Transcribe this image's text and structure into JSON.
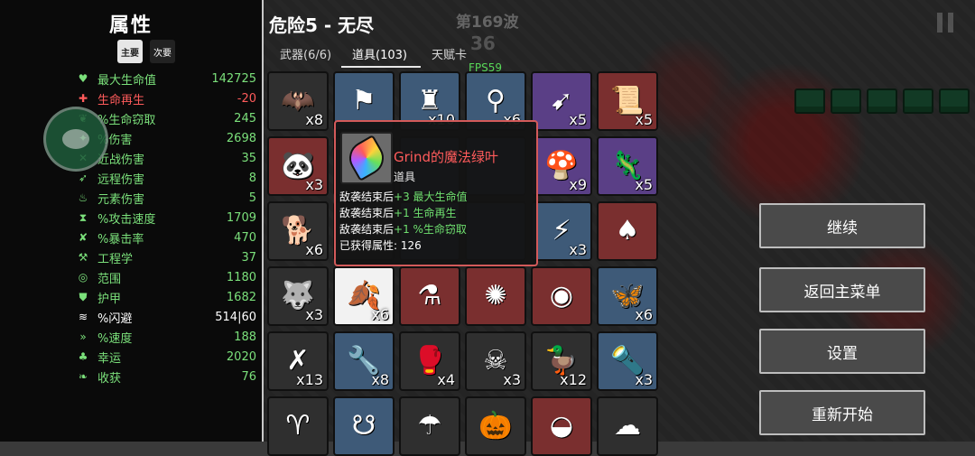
{
  "header": {
    "title": "危险5 - 无尽",
    "wave_label": "第169波",
    "wave_count": "36",
    "fps": "FPS59"
  },
  "tabs": [
    {
      "label": "武器(6/6)",
      "active": false
    },
    {
      "label": "道具(103)",
      "active": true
    },
    {
      "label": "天赋卡",
      "active": false
    }
  ],
  "stats_panel": {
    "title": "属性",
    "toggle": [
      {
        "label": "主要",
        "active": true
      },
      {
        "label": "次要",
        "active": false
      }
    ],
    "stats": [
      {
        "icon": "heart-icon",
        "glyph": "♥",
        "label": "最大生命值",
        "value": "142725",
        "color": "#7be07b"
      },
      {
        "icon": "regen-icon",
        "glyph": "✚",
        "label": "生命再生",
        "value": "-20",
        "color": "#ff5b5b"
      },
      {
        "icon": "lifesteal-icon",
        "glyph": "❦",
        "label": "%生命窃取",
        "value": "245",
        "color": "#7be07b"
      },
      {
        "icon": "damage-icon",
        "glyph": "✦",
        "label": "%伤害",
        "value": "2698",
        "color": "#7be07b"
      },
      {
        "icon": "melee-icon",
        "glyph": "✕",
        "label": "近战伤害",
        "value": "35",
        "color": "#7be07b"
      },
      {
        "icon": "ranged-icon",
        "glyph": "➶",
        "label": "远程伤害",
        "value": "8",
        "color": "#7be07b"
      },
      {
        "icon": "elemental-icon",
        "glyph": "♨",
        "label": "元素伤害",
        "value": "5",
        "color": "#7be07b"
      },
      {
        "icon": "attack-speed-icon",
        "glyph": "⧗",
        "label": "%攻击速度",
        "value": "1709",
        "color": "#7be07b"
      },
      {
        "icon": "crit-icon",
        "glyph": "✘",
        "label": "%暴击率",
        "value": "470",
        "color": "#7be07b"
      },
      {
        "icon": "engineering-icon",
        "glyph": "⚒",
        "label": "工程学",
        "value": "37",
        "color": "#7be07b"
      },
      {
        "icon": "range-icon",
        "glyph": "◎",
        "label": "范围",
        "value": "1180",
        "color": "#7be07b"
      },
      {
        "icon": "armor-icon",
        "glyph": "⛊",
        "label": "护甲",
        "value": "1682",
        "color": "#7be07b"
      },
      {
        "icon": "dodge-icon",
        "glyph": "≋",
        "label": "%闪避",
        "value": "514|60",
        "color": "#ffffff"
      },
      {
        "icon": "speed-icon",
        "glyph": "»",
        "label": "%速度",
        "value": "188",
        "color": "#7be07b"
      },
      {
        "icon": "luck-icon",
        "glyph": "♣",
        "label": "幸运",
        "value": "2020",
        "color": "#7be07b"
      },
      {
        "icon": "harvest-icon",
        "glyph": "❧",
        "label": "收获",
        "value": "76",
        "color": "#7be07b"
      }
    ]
  },
  "items": [
    {
      "name": "item-bat",
      "glyph": "🦇",
      "rarity": "r-gray",
      "qty": "x8"
    },
    {
      "name": "item-banner",
      "glyph": "⚑",
      "rarity": "r-blue",
      "qty": ""
    },
    {
      "name": "item-totem",
      "glyph": "♜",
      "rarity": "r-blue",
      "qty": "x10"
    },
    {
      "name": "item-cannon",
      "glyph": "⚲",
      "rarity": "r-blue",
      "qty": "x6"
    },
    {
      "name": "item-rocket",
      "glyph": "➹",
      "rarity": "r-purple",
      "qty": "x5"
    },
    {
      "name": "item-scroll",
      "glyph": "📜",
      "rarity": "r-red",
      "qty": "x5"
    },
    {
      "name": "item-panda",
      "glyph": "🐼",
      "rarity": "r-red",
      "qty": "x3"
    },
    {
      "name": "item-hidden-1",
      "glyph": "",
      "rarity": "r-gray",
      "qty": ""
    },
    {
      "name": "item-hidden-2",
      "glyph": "",
      "rarity": "r-blue",
      "qty": ""
    },
    {
      "name": "item-hidden-3",
      "glyph": "",
      "rarity": "r-blue",
      "qty": ""
    },
    {
      "name": "item-mushroom",
      "glyph": "🍄",
      "rarity": "r-purple",
      "qty": "x9"
    },
    {
      "name": "item-chameleon",
      "glyph": "🦎",
      "rarity": "r-purple",
      "qty": "x5"
    },
    {
      "name": "item-dog",
      "glyph": "🐕",
      "rarity": "r-gray",
      "qty": "x6"
    },
    {
      "name": "item-hidden-4",
      "glyph": "",
      "rarity": "r-gray",
      "qty": ""
    },
    {
      "name": "item-hidden-5",
      "glyph": "",
      "rarity": "r-blue",
      "qty": ""
    },
    {
      "name": "item-hidden-6",
      "glyph": "",
      "rarity": "r-blue",
      "qty": ""
    },
    {
      "name": "item-net",
      "glyph": "⚡",
      "rarity": "r-blue",
      "qty": "x3"
    },
    {
      "name": "item-stomach",
      "glyph": "♠",
      "rarity": "r-red",
      "qty": ""
    },
    {
      "name": "item-wolf",
      "glyph": "🐺",
      "rarity": "r-gray",
      "qty": "x3"
    },
    {
      "name": "item-rainbow-leaf",
      "glyph": "🍂",
      "rarity": "r-white",
      "qty": "x6"
    },
    {
      "name": "item-potion",
      "glyph": "⚗",
      "rarity": "r-red",
      "qty": ""
    },
    {
      "name": "item-virus",
      "glyph": "✺",
      "rarity": "r-red",
      "qty": ""
    },
    {
      "name": "item-coin",
      "glyph": "◉",
      "rarity": "r-red",
      "qty": ""
    },
    {
      "name": "item-dragonfly",
      "glyph": "🦋",
      "rarity": "r-blue",
      "qty": "x6"
    },
    {
      "name": "item-claw",
      "glyph": "✗",
      "rarity": "r-gray",
      "qty": "x13"
    },
    {
      "name": "item-wrench",
      "glyph": "🔧",
      "rarity": "r-blue",
      "qty": "x8"
    },
    {
      "name": "item-glove",
      "glyph": "🥊",
      "rarity": "r-gray",
      "qty": "x4"
    },
    {
      "name": "item-skull",
      "glyph": "☠",
      "rarity": "r-gray",
      "qty": "x3"
    },
    {
      "name": "item-duck",
      "glyph": "🦆",
      "rarity": "r-gray",
      "qty": "x12"
    },
    {
      "name": "item-flashlight",
      "glyph": "🔦",
      "rarity": "r-blue",
      "qty": "x3"
    },
    {
      "name": "item-horns",
      "glyph": "♈",
      "rarity": "r-gray",
      "qty": ""
    },
    {
      "name": "item-demon",
      "glyph": "☋",
      "rarity": "r-blue",
      "qty": ""
    },
    {
      "name": "item-cloak",
      "glyph": "☂",
      "rarity": "r-gray",
      "qty": ""
    },
    {
      "name": "item-pumpkin",
      "glyph": "🎃",
      "rarity": "r-gray",
      "qty": ""
    },
    {
      "name": "item-plate",
      "glyph": "◒",
      "rarity": "r-red",
      "qty": ""
    },
    {
      "name": "item-ghost",
      "glyph": "☁",
      "rarity": "r-gray",
      "qty": ""
    }
  ],
  "tooltip": {
    "name": "Grind的魔法绿叶",
    "type": "道具",
    "lines": [
      {
        "prefix": "敌袭结束后",
        "effect": "+3 最大生命值"
      },
      {
        "prefix": "敌袭结束后",
        "effect": "+1 生命再生"
      },
      {
        "prefix": "敌袭结束后",
        "effect": "+1 %生命窃取"
      }
    ],
    "acquired": "已获得属性: 126"
  },
  "menu": {
    "continue": "继续",
    "main_menu": "返回主菜单",
    "settings": "设置",
    "restart": "重新开始"
  }
}
